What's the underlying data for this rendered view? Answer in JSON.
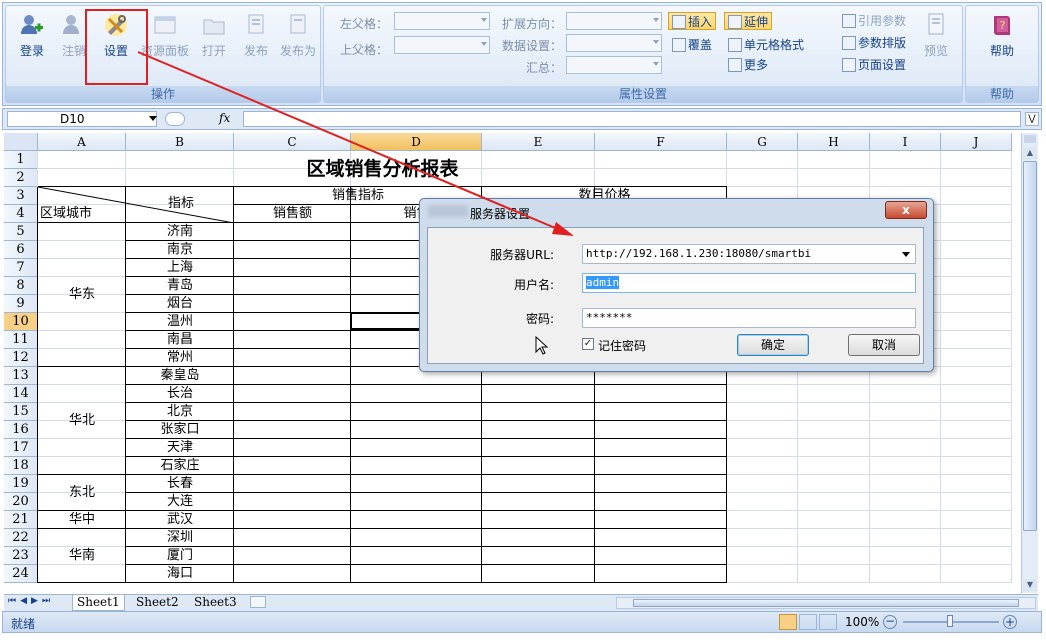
{
  "ribbon": {
    "buttons": {
      "login": "登录",
      "logout": "注销",
      "settings": "设置",
      "resource_panel": "资源面板",
      "open": "打开",
      "publish": "发布",
      "publish_as": "发布为",
      "help": "帮助"
    },
    "group_titles": {
      "operations": "操作",
      "properties": "属性设置",
      "help": "帮助"
    },
    "properties": {
      "left_parent": "左父格：",
      "top_parent": "上父格：",
      "expand_direction": "扩展方向：",
      "data_settings": "数据设置：",
      "summary": "汇总：",
      "insert": "插入",
      "extend": "延伸",
      "cover": "覆盖",
      "cell_format": "单元格格式",
      "more": "更多",
      "ref_params": "引用参数",
      "param_layout": "参数排版",
      "page_settings": "页面设置",
      "preview": "预览"
    }
  },
  "formula_bar": {
    "cell_ref": "D10",
    "fx": "fx"
  },
  "sheet": {
    "columns": [
      "A",
      "B",
      "C",
      "D",
      "E",
      "F",
      "G",
      "H",
      "I",
      "J"
    ],
    "selected_column": "D",
    "rows": [
      "1",
      "2",
      "3",
      "4",
      "5",
      "6",
      "7",
      "8",
      "9",
      "10",
      "11",
      "12",
      "13",
      "14",
      "15",
      "16",
      "17",
      "18",
      "19",
      "20",
      "21",
      "22",
      "23",
      "24"
    ],
    "selected_row": "10",
    "title": "区域销售分析报表",
    "header": {
      "region_city": "区域城市",
      "indicator": "指标",
      "sales_indicator": "销售指标",
      "sales_amount": "销售额",
      "sales_partial": "销售",
      "count_price": "数目价格"
    },
    "regions": [
      {
        "name": "华东",
        "cities": [
          "济南",
          "南京",
          "上海",
          "青岛",
          "烟台",
          "温州",
          "南昌",
          "常州"
        ]
      },
      {
        "name": "华北",
        "cities": [
          "秦皇岛",
          "长治",
          "北京",
          "张家口",
          "天津",
          "石家庄"
        ]
      },
      {
        "name": "东北",
        "cities": [
          "长春",
          "大连"
        ]
      },
      {
        "name": "华中",
        "cities": [
          "武汉"
        ]
      },
      {
        "name": "华南",
        "cities": [
          "深圳",
          "厦门",
          "海口"
        ]
      }
    ]
  },
  "tabs": [
    "Sheet1",
    "Sheet2",
    "Sheet3"
  ],
  "status": {
    "ready": "就绪",
    "zoom": "100%"
  },
  "dialog": {
    "title": "服务器设置",
    "close": "x",
    "url_label": "服务器URL:",
    "url_value": "http://192.168.1.230:18080/smartbi",
    "user_label": "用户名:",
    "user_value": "admin",
    "password_label": "密码:",
    "password_value": "*******",
    "remember_label": "记住密码",
    "ok": "确定",
    "cancel": "取消"
  },
  "colors": {
    "annotation": "#e02020",
    "selection": "#f1c15f",
    "ribbon": "#d3e2f6"
  }
}
